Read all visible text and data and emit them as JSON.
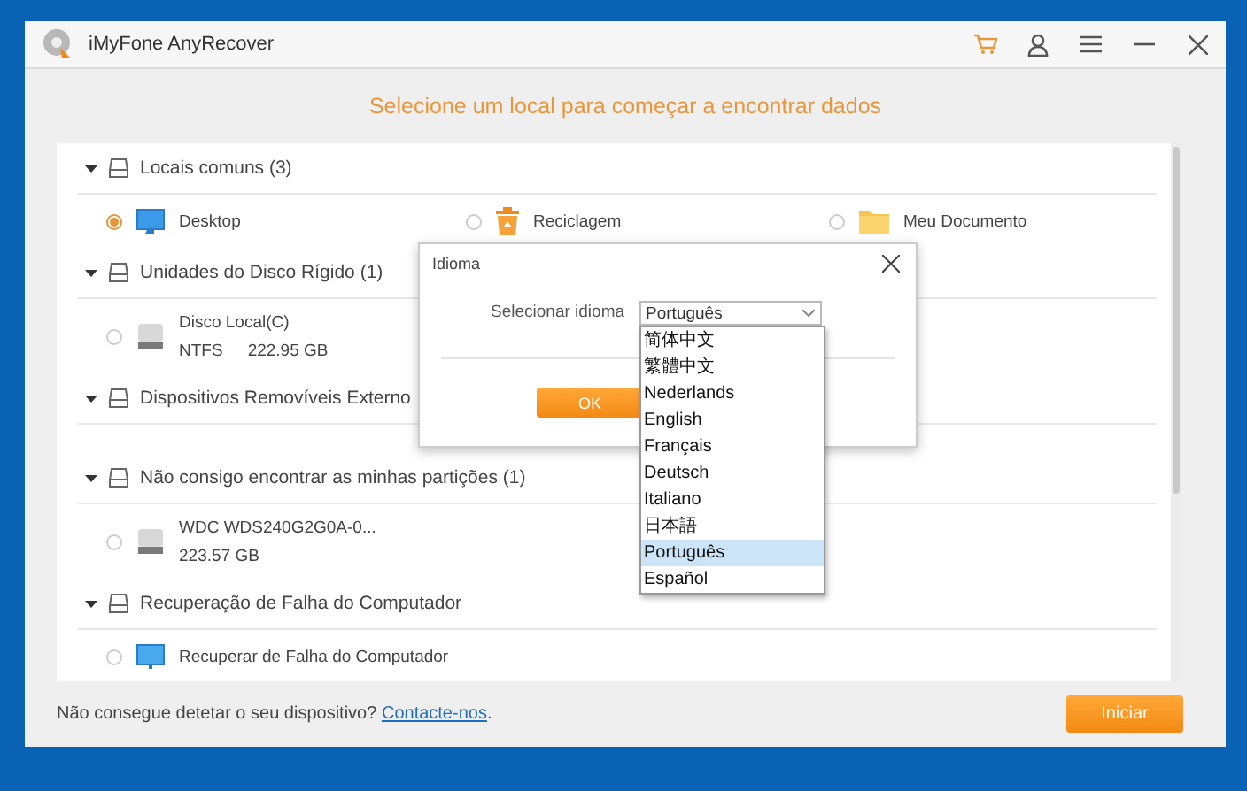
{
  "window": {
    "title": "iMyFone AnyRecover"
  },
  "header": "Selecione um local para começar a encontrar dados",
  "sections": [
    {
      "label": "Locais comuns (3)",
      "expanded": true,
      "items": [
        {
          "kind": "desktop",
          "name": "Desktop",
          "selected": true
        },
        {
          "kind": "recycle",
          "name": "Reciclagem",
          "selected": false
        },
        {
          "kind": "folder",
          "name": "Meu Documento",
          "selected": false
        }
      ]
    },
    {
      "label": "Unidades do Disco Rígido (1)",
      "expanded": true,
      "items": [
        {
          "kind": "drive",
          "name": "Disco Local(C)",
          "filesystem": "NTFS",
          "size": "222.95 GB",
          "selected": false
        }
      ]
    },
    {
      "label": "Dispositivos Removíveis Externo",
      "expanded": true
    },
    {
      "label": "Não consigo encontrar as minhas partições (1)",
      "expanded": true,
      "items": [
        {
          "kind": "drive",
          "name": "WDC WDS240G2G0A-0...",
          "size": "223.57 GB",
          "selected": false
        }
      ]
    },
    {
      "label": "Recuperação de Falha do Computador",
      "expanded": true,
      "items": [
        {
          "kind": "monitor",
          "name": "Recuperar de Falha do Computador",
          "selected": false
        }
      ]
    }
  ],
  "footer": {
    "text": "Não consegue detetar o seu dispositivo?",
    "link": "Contacte-nos",
    "after": ".",
    "button": "Iniciar"
  },
  "dialog": {
    "title": "Idioma",
    "label": "Selecionar idioma",
    "value": "Português",
    "button": "OK",
    "options": [
      {
        "label": "简体中文",
        "selected": false
      },
      {
        "label": "繁體中文",
        "selected": false
      },
      {
        "label": "Nederlands",
        "selected": false
      },
      {
        "label": "English",
        "selected": false
      },
      {
        "label": "Français",
        "selected": false
      },
      {
        "label": "Deutsch",
        "selected": false
      },
      {
        "label": "Italiano",
        "selected": false
      },
      {
        "label": "日本語",
        "selected": false
      },
      {
        "label": "Português",
        "selected": true
      },
      {
        "label": "Español",
        "selected": false
      }
    ]
  }
}
